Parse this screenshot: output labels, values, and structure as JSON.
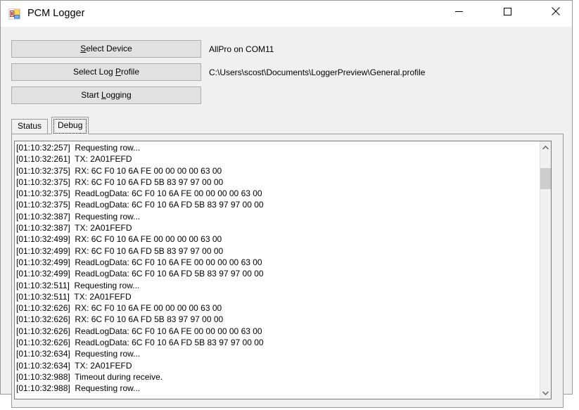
{
  "window": {
    "title": "PCM Logger",
    "icon": "app-icon",
    "controls": {
      "minimize": "minimize-icon",
      "maximize": "maximize-icon",
      "close": "close-icon"
    }
  },
  "toolbar": {
    "select_device": {
      "pre": "",
      "accel": "S",
      "post": "elect Device"
    },
    "select_profile": {
      "pre": "Select Log ",
      "accel": "P",
      "post": "rofile"
    },
    "start_logging": {
      "pre": "Start ",
      "accel": "L",
      "post": "ogging"
    },
    "device_status": "AllPro on COM11",
    "profile_path": "C:\\Users\\scost\\Documents\\LoggerPreview\\General.profile"
  },
  "tabs": [
    {
      "label": "Status",
      "selected": false
    },
    {
      "label": "Debug",
      "selected": true
    }
  ],
  "log": {
    "lines": [
      "[01:10:32:257]  Requesting row...",
      "[01:10:32:261]  TX: 2A01FEFD",
      "[01:10:32:375]  RX: 6C F0 10 6A FE 00 00 00 00 63 00",
      "[01:10:32:375]  RX: 6C F0 10 6A FD 5B 83 97 97 00 00",
      "[01:10:32:375]  ReadLogData: 6C F0 10 6A FE 00 00 00 00 63 00",
      "[01:10:32:375]  ReadLogData: 6C F0 10 6A FD 5B 83 97 97 00 00",
      "[01:10:32:387]  Requesting row...",
      "[01:10:32:387]  TX: 2A01FEFD",
      "[01:10:32:499]  RX: 6C F0 10 6A FE 00 00 00 00 63 00",
      "[01:10:32:499]  RX: 6C F0 10 6A FD 5B 83 97 97 00 00",
      "[01:10:32:499]  ReadLogData: 6C F0 10 6A FE 00 00 00 00 63 00",
      "[01:10:32:499]  ReadLogData: 6C F0 10 6A FD 5B 83 97 97 00 00",
      "[01:10:32:511]  Requesting row...",
      "[01:10:32:511]  TX: 2A01FEFD",
      "[01:10:32:626]  RX: 6C F0 10 6A FE 00 00 00 00 63 00",
      "[01:10:32:626]  RX: 6C F0 10 6A FD 5B 83 97 97 00 00",
      "[01:10:32:626]  ReadLogData: 6C F0 10 6A FE 00 00 00 00 63 00",
      "[01:10:32:626]  ReadLogData: 6C F0 10 6A FD 5B 83 97 97 00 00",
      "[01:10:32:634]  Requesting row...",
      "[01:10:32:634]  TX: 2A01FEFD",
      "[01:10:32:988]  Timeout during receive.",
      "[01:10:32:988]  Requesting row..."
    ],
    "scrollbar": {
      "up_arrow": "chevron-up-icon",
      "down_arrow": "chevron-down-icon"
    }
  },
  "colors": {
    "window_bg": "#f0f0f0",
    "button_face": "#e1e1e1",
    "button_border": "#adadad",
    "text": "#000000",
    "field_bg": "#ffffff",
    "scroll_thumb": "#cdcdcd"
  }
}
